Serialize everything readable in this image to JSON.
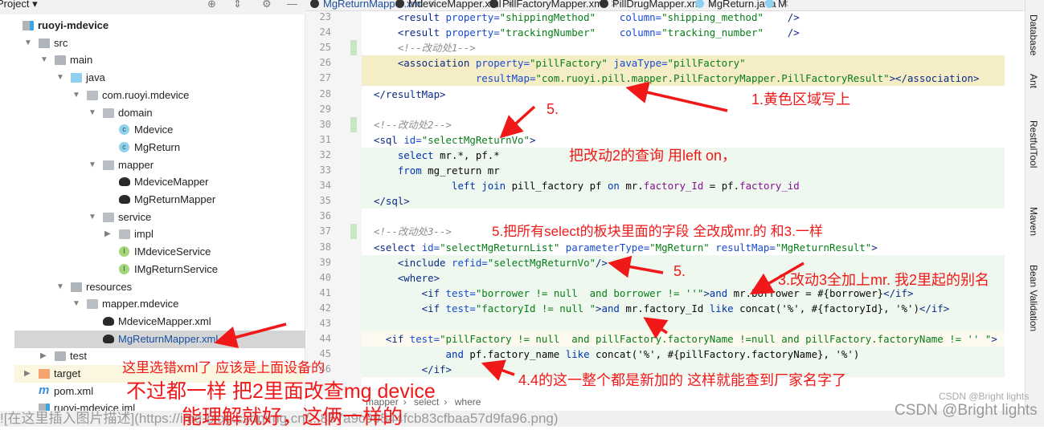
{
  "project_panel": {
    "title": "Project ▾",
    "tree": [
      {
        "label": "ruoyi-mdevice",
        "level": 0,
        "arrow": "",
        "icon": "module-folder-icon",
        "bold": true
      },
      {
        "label": "src",
        "level": 1,
        "arrow": "▼",
        "icon": "folder-icon"
      },
      {
        "label": "main",
        "level": 2,
        "arrow": "▼",
        "icon": "folder-icon"
      },
      {
        "label": "java",
        "level": 3,
        "arrow": "▼",
        "icon": "source-folder-icon"
      },
      {
        "label": "com.ruoyi.mdevice",
        "level": 4,
        "arrow": "▼",
        "icon": "package-icon"
      },
      {
        "label": "domain",
        "level": 5,
        "arrow": "▼",
        "icon": "package-icon"
      },
      {
        "label": "Mdevice",
        "level": 6,
        "arrow": "",
        "icon": "class-icon"
      },
      {
        "label": "MgReturn",
        "level": 6,
        "arrow": "",
        "icon": "class-icon"
      },
      {
        "label": "mapper",
        "level": 5,
        "arrow": "▼",
        "icon": "package-icon"
      },
      {
        "label": "MdeviceMapper",
        "level": 6,
        "arrow": "",
        "icon": "mybatis-icon"
      },
      {
        "label": "MgReturnMapper",
        "level": 6,
        "arrow": "",
        "icon": "mybatis-icon"
      },
      {
        "label": "service",
        "level": 5,
        "arrow": "▼",
        "icon": "package-icon"
      },
      {
        "label": "impl",
        "level": 6,
        "arrow": "▶",
        "icon": "package-icon"
      },
      {
        "label": "IMdeviceService",
        "level": 6,
        "arrow": "",
        "icon": "interface-icon"
      },
      {
        "label": "IMgReturnService",
        "level": 6,
        "arrow": "",
        "icon": "interface-icon"
      },
      {
        "label": "resources",
        "level": 3,
        "arrow": "▼",
        "icon": "folder-icon"
      },
      {
        "label": "mapper.mdevice",
        "level": 4,
        "arrow": "▼",
        "icon": "package-icon"
      },
      {
        "label": "MdeviceMapper.xml",
        "level": 5,
        "arrow": "",
        "icon": "mybatis-icon"
      },
      {
        "label": "MgReturnMapper.xml",
        "level": 5,
        "arrow": "",
        "icon": "mybatis-icon",
        "selected": true
      },
      {
        "label": "test",
        "level": 2,
        "arrow": "▶",
        "icon": "folder-icon"
      },
      {
        "label": "target",
        "level": 1,
        "arrow": "▶",
        "icon": "excluded-folder-icon",
        "highlight": true
      },
      {
        "label": "pom.xml",
        "level": 1,
        "arrow": "",
        "icon": "maven-icon"
      },
      {
        "label": "ruoyi-mdevice.iml",
        "level": 1,
        "arrow": "",
        "icon": "module-folder-icon"
      }
    ]
  },
  "tabs": [
    {
      "label": "MgReturnMapper.xml",
      "icon": "mybatis-icon",
      "active": true
    },
    {
      "label": "MdeviceMapper.xml",
      "icon": "mybatis-icon"
    },
    {
      "label": "PillFactoryMapper.xml",
      "icon": "mybatis-icon"
    },
    {
      "label": "PillDrugMapper.xml",
      "icon": "mybatis-icon"
    },
    {
      "label": "MgReturn.java",
      "icon": "class-icon"
    },
    {
      "label": "M",
      "icon": "class-icon"
    }
  ],
  "editor": {
    "lines": [
      {
        "num": "23",
        "bg": "",
        "tokens": [
          [
            "    <result ",
            "t"
          ],
          [
            "property=",
            "a"
          ],
          [
            "\"shippingMethod\"",
            "s"
          ],
          [
            "    ",
            "n"
          ],
          [
            "column=",
            "a"
          ],
          [
            "\"shipping_method\"",
            "s"
          ],
          [
            "    />",
            "t"
          ]
        ]
      },
      {
        "num": "24",
        "bg": "",
        "tokens": [
          [
            "    <result ",
            "t"
          ],
          [
            "property=",
            "a"
          ],
          [
            "\"trackingNumber\"",
            "s"
          ],
          [
            "    ",
            "n"
          ],
          [
            "column=",
            "a"
          ],
          [
            "\"tracking_number\"",
            "s"
          ],
          [
            "    />",
            "t"
          ]
        ]
      },
      {
        "num": "25",
        "bg": "",
        "tokens": [
          [
            "    <!--改动处1-->",
            "c"
          ]
        ]
      },
      {
        "num": "26",
        "bg": "y",
        "tokens": [
          [
            "    <association ",
            "t"
          ],
          [
            "property=",
            "a"
          ],
          [
            "\"pillFactory\" ",
            "s"
          ],
          [
            "javaType=",
            "a"
          ],
          [
            "\"pillFactory\"",
            "s"
          ]
        ]
      },
      {
        "num": "27",
        "bg": "y",
        "tokens": [
          [
            "                 ",
            "n"
          ],
          [
            "resultMap=",
            "a"
          ],
          [
            "\"com.ruoyi.pill.mapper.PillFactoryMapper.PillFactoryResult\"",
            "s"
          ],
          [
            "></association>",
            "t"
          ]
        ]
      },
      {
        "num": "28",
        "bg": "",
        "tokens": [
          [
            "</resultMap>",
            "t"
          ]
        ]
      },
      {
        "num": "29",
        "bg": "",
        "tokens": []
      },
      {
        "num": "30",
        "bg": "",
        "tokens": [
          [
            "<!--改动处2-->",
            "c"
          ]
        ]
      },
      {
        "num": "31",
        "bg": "",
        "tokens": [
          [
            "<sql ",
            "t"
          ],
          [
            "id=",
            "a"
          ],
          [
            "\"selectMgReturnVo\"",
            "s"
          ],
          [
            ">",
            "t"
          ]
        ]
      },
      {
        "num": "32",
        "bg": "g",
        "tokens": [
          [
            "    ",
            "n"
          ],
          [
            "select ",
            "k"
          ],
          [
            "mr.*, pf.*",
            "n"
          ]
        ]
      },
      {
        "num": "33",
        "bg": "g",
        "tokens": [
          [
            "    ",
            "n"
          ],
          [
            "from ",
            "k"
          ],
          [
            "mg_return mr",
            "n"
          ]
        ]
      },
      {
        "num": "34",
        "bg": "g",
        "tokens": [
          [
            "             ",
            "n"
          ],
          [
            "left join ",
            "k"
          ],
          [
            "pill_factory pf ",
            "n"
          ],
          [
            "on ",
            "k"
          ],
          [
            "mr.",
            "n"
          ],
          [
            "factory_Id",
            "p"
          ],
          [
            " = pf.",
            "n"
          ],
          [
            "factory_id",
            "p"
          ]
        ]
      },
      {
        "num": "35",
        "bg": "g",
        "tokens": [
          [
            "</sql>",
            "t"
          ]
        ]
      },
      {
        "num": "36",
        "bg": "",
        "tokens": []
      },
      {
        "num": "37",
        "bg": "",
        "tokens": [
          [
            "<!--改动处3-->",
            "c"
          ]
        ]
      },
      {
        "num": "38",
        "bg": "",
        "tokens": [
          [
            "<select ",
            "t"
          ],
          [
            "id=",
            "a"
          ],
          [
            "\"selectMgReturnList\" ",
            "s"
          ],
          [
            "parameterType=",
            "a"
          ],
          [
            "\"MgReturn\" ",
            "s"
          ],
          [
            "resultMap=",
            "a"
          ],
          [
            "\"MgReturnResult\"",
            "s"
          ],
          [
            ">",
            "t"
          ]
        ]
      },
      {
        "num": "39",
        "bg": "g",
        "tokens": [
          [
            "    <include ",
            "t"
          ],
          [
            "refid=",
            "a"
          ],
          [
            "\"selectMgReturnVo\"",
            "s"
          ],
          [
            "/>",
            "t"
          ]
        ]
      },
      {
        "num": "40",
        "bg": "g",
        "tokens": [
          [
            "    <where>",
            "t"
          ]
        ]
      },
      {
        "num": "41",
        "bg": "g",
        "tokens": [
          [
            "        <if ",
            "t"
          ],
          [
            "test=",
            "a"
          ],
          [
            "\"borrower != null  and borrower != ''\"",
            "s"
          ],
          [
            ">",
            "t"
          ],
          [
            "and ",
            "k"
          ],
          [
            "mr.borrower = #{borrower}",
            "n"
          ],
          [
            "</if>",
            "t"
          ]
        ]
      },
      {
        "num": "42",
        "bg": "g",
        "tokens": [
          [
            "        <if ",
            "t"
          ],
          [
            "test=",
            "a"
          ],
          [
            "\"factoryId != null \"",
            "s"
          ],
          [
            ">",
            "t"
          ],
          [
            "and ",
            "k"
          ],
          [
            "mr.factory_Id ",
            "n"
          ],
          [
            "like ",
            "k"
          ],
          [
            "concat('%', #{factoryId}, '%')",
            "n"
          ],
          [
            "</if>",
            "t"
          ]
        ]
      },
      {
        "num": "43",
        "bg": "g",
        "tokens": []
      },
      {
        "num": "44",
        "bg": "c",
        "tokens": [
          [
            "  <if ",
            "t"
          ],
          [
            "test=",
            "a"
          ],
          [
            "\"pillFactory != null  and pillFactory.factoryName !=null and pillFactory.factoryName != '' \"",
            "s"
          ],
          [
            ">",
            "t"
          ]
        ]
      },
      {
        "num": "45",
        "bg": "g",
        "tokens": [
          [
            "            ",
            "n"
          ],
          [
            "and ",
            "k"
          ],
          [
            "pf.factory_name ",
            "n"
          ],
          [
            "like ",
            "k"
          ],
          [
            "concat('%', #{pillFactory.factoryName}, '%')",
            "n"
          ]
        ]
      },
      {
        "num": "46",
        "bg": "g",
        "tokens": [
          [
            "        </if>",
            "t"
          ]
        ]
      }
    ]
  },
  "breadcrumb": [
    "mapper",
    "select",
    "where"
  ],
  "right_tools": [
    "Database",
    "Ant",
    "RestfulTool",
    "Maven",
    "Bean Validation"
  ],
  "annotations": {
    "a1": "1.黄色区域写上",
    "a5top": "5.",
    "a2": "把改动2的查询 用left on，",
    "a5all": "5.把所有select的板块里面的字段 全改成mr.的 和3.一样",
    "a5mid": "5.",
    "a3": "3.改动3全加上mr. 我2里起的别名",
    "a4": "4.4的这一整个都是新加的  这样就能查到厂家名字了",
    "wrong1": "这里选错xml了 应该是上面设备的",
    "wrong2": "不过都一样 把2里面改查mg  device",
    "wrong3": "能理解就好，这俩一样的"
  },
  "bottom_text": "![在这里插入图片描述](https://img-blog.csdnimg.cn/...867a9c99544fcb83cfbaa57d9fa96.png)",
  "watermark": {
    "small": "CSDN @Bright lights",
    "large": "CSDN @Bright lights"
  },
  "colors": {
    "annotation": "#f01818",
    "selection": "#d5d5d5",
    "highlight_yellow": "#f5edc6",
    "changed_green": "#eef8ee"
  }
}
